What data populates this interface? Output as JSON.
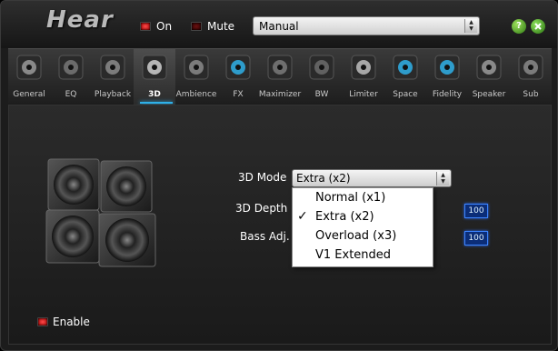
{
  "app": {
    "title": "Hear"
  },
  "toggles": {
    "on_label": "On",
    "mute_label": "Mute"
  },
  "preset": {
    "value": "Manual"
  },
  "help_label": "?",
  "tabs": [
    {
      "label": "General",
      "icon": "general-icon"
    },
    {
      "label": "EQ",
      "icon": "eq-icon"
    },
    {
      "label": "Playback",
      "icon": "playback-icon"
    },
    {
      "label": "3D",
      "icon": "speakers-3d-icon",
      "active": true
    },
    {
      "label": "Ambience",
      "icon": "ambience-icon"
    },
    {
      "label": "FX",
      "icon": "fx-icon"
    },
    {
      "label": "Maximizer",
      "icon": "headphones-icon"
    },
    {
      "label": "BW",
      "icon": "bw-icon"
    },
    {
      "label": "Limiter",
      "icon": "limiter-icon"
    },
    {
      "label": "Space",
      "icon": "space-icon"
    },
    {
      "label": "Fidelity",
      "icon": "fidelity-icon"
    },
    {
      "label": "Speaker",
      "icon": "speaker-icon"
    },
    {
      "label": "Sub",
      "icon": "subwoofer-icon"
    }
  ],
  "panel_3d": {
    "mode_label": "3D Mode",
    "mode_value": "Extra (x2)",
    "depth_label": "3D Depth",
    "depth_value": "100",
    "bass_label": "Bass Adj.",
    "bass_value": "100",
    "dropdown": [
      {
        "label": "Normal (x1)",
        "checked": false
      },
      {
        "label": "Extra (x2)",
        "checked": true
      },
      {
        "label": "Overload (x3)",
        "checked": false
      },
      {
        "label": "V1 Extended",
        "checked": false
      }
    ],
    "enable_label": "Enable"
  },
  "colors": {
    "accent": "#2fb0e8",
    "led_on": "#ff2a2a",
    "value_box": "#0b2d78"
  }
}
